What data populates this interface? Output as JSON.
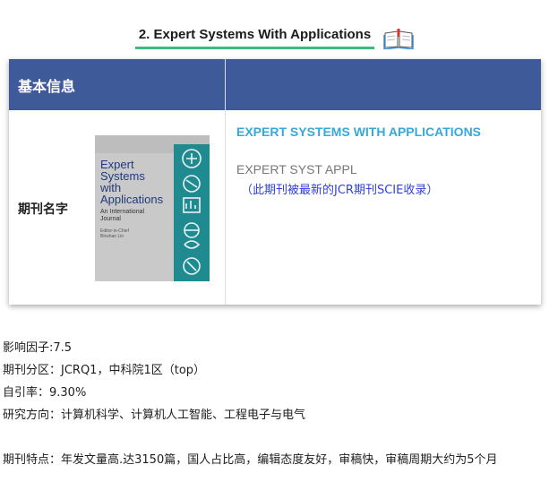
{
  "heading": {
    "title": "2. Expert Systems With Applications",
    "icon": "open-book-icon"
  },
  "table": {
    "header_label": "基本信息",
    "row_label": "期刊名字",
    "cover": {
      "title_lines": [
        "Expert",
        "Systems",
        "with",
        "Applications"
      ],
      "subtitle_lines": [
        "An International",
        "Journal"
      ],
      "editor_lines": [
        "Editor-in-Chief",
        "Binshan Lin"
      ]
    },
    "full_name": "EXPERT SYSTEMS WITH APPLICATIONS",
    "abbreviation": "EXPERT SYST APPL",
    "note": "（此期刊被最新的JCR期刊SCIE收录）"
  },
  "details": [
    "影响因子:7.5",
    "期刊分区：JCRQ1，中科院1区（top）",
    "自引率：9.30%",
    "研究方向：计算机科学、计算机人工智能、工程电子与电气"
  ],
  "features": "期刊特点：年发文量高.达3150篇，国人占比高，编辑态度友好，审稿快，审稿周期大约为5个月",
  "colors": {
    "header_bg": "#3f5a99",
    "accent_green": "#3dbb7d",
    "journal_blue": "#35a9dd",
    "note_blue": "#2f3fdc"
  }
}
